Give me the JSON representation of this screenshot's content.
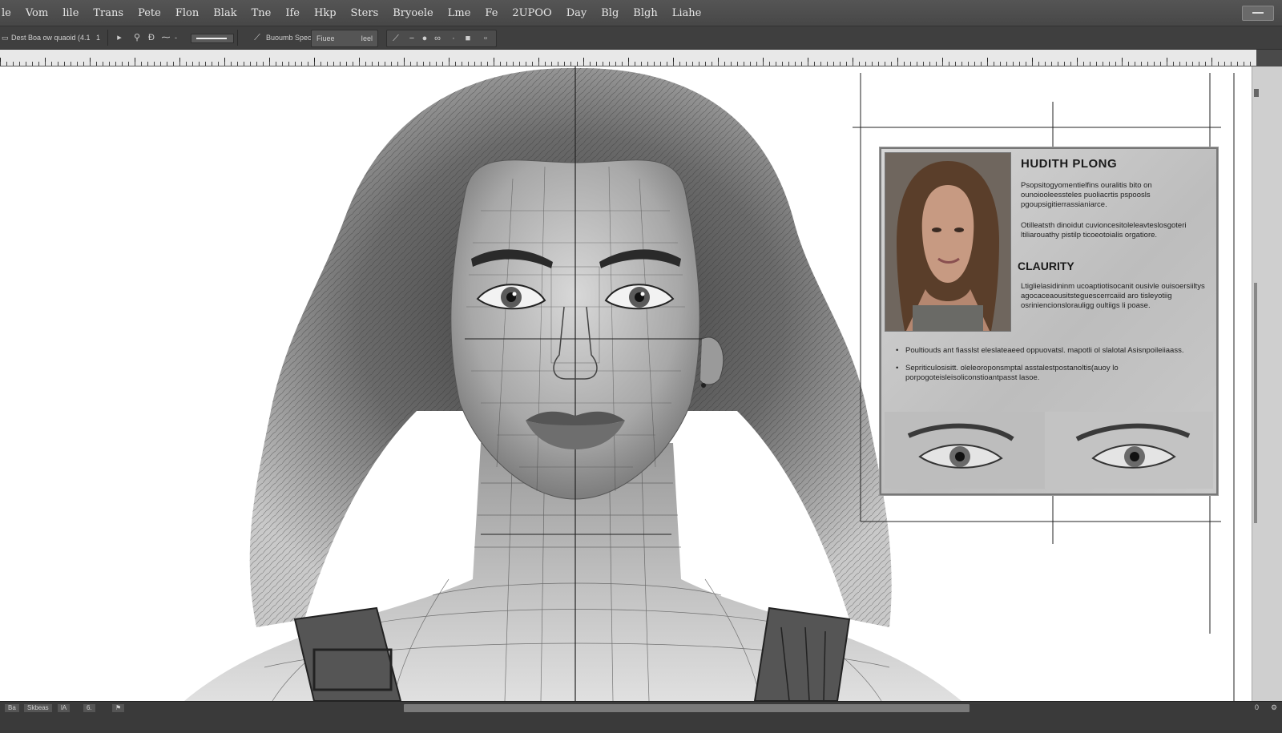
{
  "menubar": {
    "items": [
      "le",
      "Vom",
      "lile",
      "Trans",
      "Pete",
      "Flon",
      "Blak",
      "Tne",
      "Ife",
      "Hkp",
      "Sters",
      "Bryoele",
      "Lme",
      "Fe",
      "2UPOO",
      "Day",
      "Blg",
      "Blgh",
      "Liahe"
    ]
  },
  "optionsbar": {
    "preset": "Dest Boa ow quaoid (4.1",
    "size_label": "1",
    "brush_field": "Buoumb Spece",
    "mode_field": "Fiuee",
    "flow_field": "Ieel"
  },
  "card": {
    "title": "HUDITH PLONG",
    "para1": "Psopsitogyomentielfins ouralitis bito on ounoiooleessteles puoliacrtis pspoosls pgoupsigitierrassianiarce.",
    "para2": "Otilleatsth dinoidut cuvioncesitoleleavteslosgoteri ltiliarouathy pistilp ticoeotoialis orgatiore.",
    "heading": "CLAURITY",
    "para3": "Ltiglielasidininm ucoaptiotisocanit ousivle ouisoersiiltys agocaceaousitsteguescerrcaiid aro tisleyotiig osriniencionslorauligg oultiigs li poase.",
    "bullets": [
      "Poultiouds ant fiasslst eleslateaeed oppuovatsl. mapotli ol slalotal Asisnpoileiiaass.",
      "Sepriticulosisitt. oleleoroponsmptal asstalestpostanoltis(auoy lo porpogoteisleisoliconstioantpasst lasoe."
    ]
  },
  "statusbar": {
    "items": [
      "Ba",
      "Skbeas",
      "lA",
      "6."
    ],
    "zoom": "0"
  },
  "colors": {
    "chrome": "#4a4a4a",
    "menubar": "#555555",
    "canvas": "#ffffff",
    "card": "#c8c8c8"
  }
}
